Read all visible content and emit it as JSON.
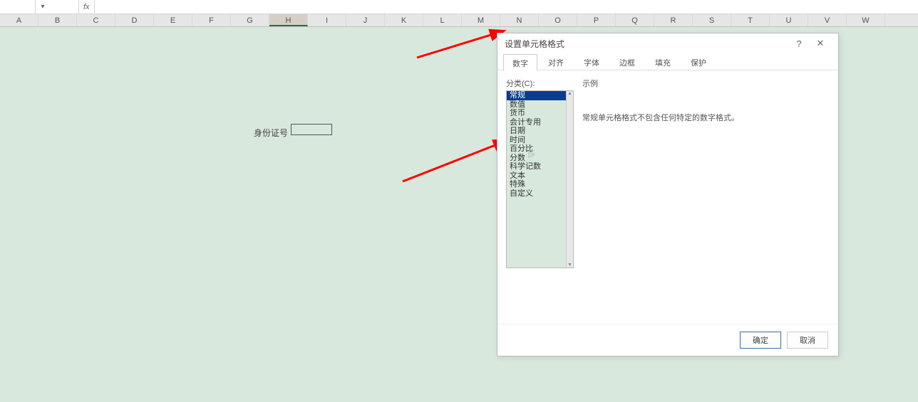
{
  "formula_bar": {
    "name_box": "",
    "fx_label": "fx"
  },
  "columns": [
    "A",
    "B",
    "C",
    "D",
    "E",
    "F",
    "G",
    "H",
    "I",
    "J",
    "K",
    "L",
    "M",
    "N",
    "O",
    "P",
    "Q",
    "R",
    "S",
    "T",
    "U",
    "V",
    "W"
  ],
  "selected_column": "H",
  "cells": {
    "label": "身份证号"
  },
  "dialog": {
    "title": "设置单元格格式",
    "help": "?",
    "close": "✕",
    "tabs": [
      "数字",
      "对齐",
      "字体",
      "边框",
      "填充",
      "保护"
    ],
    "active_tab": "数字",
    "category_label": "分类(C):",
    "categories": [
      "常规",
      "数值",
      "货币",
      "会计专用",
      "日期",
      "时间",
      "百分比",
      "分数",
      "科学记数",
      "文本",
      "特殊",
      "自定义"
    ],
    "selected_category": "常规",
    "sample_label": "示例",
    "description": "常规单元格格式不包含任何特定的数字格式。",
    "ok": "确定",
    "cancel": "取消"
  }
}
